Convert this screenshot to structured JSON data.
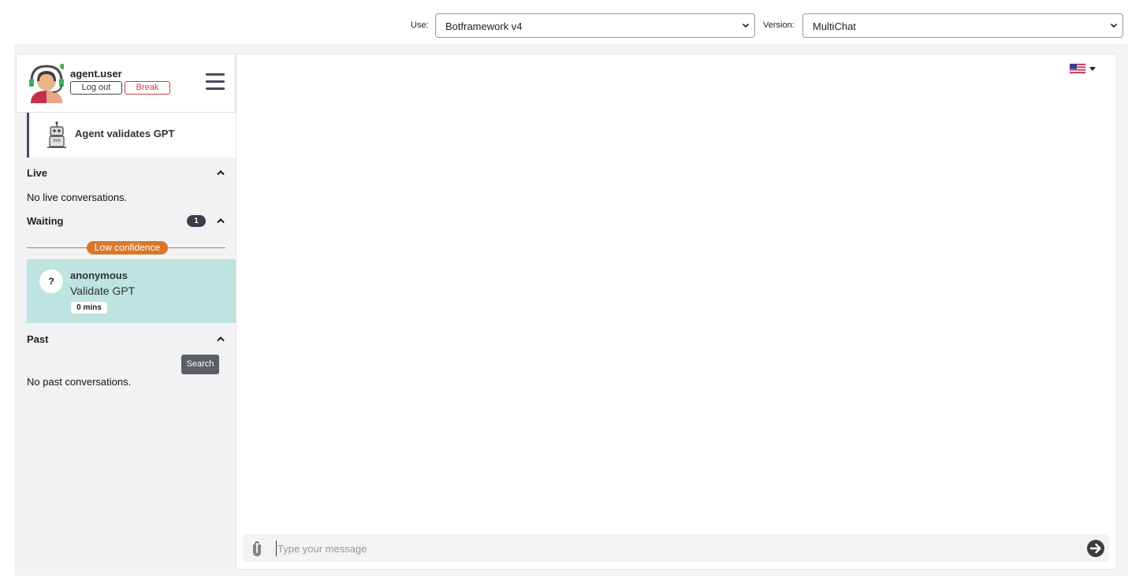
{
  "topbar": {
    "use_label": "Use:",
    "use_value": "Botframework v4",
    "version_label": "Version:",
    "version_value": "MultiChat"
  },
  "agent": {
    "name": "agent.user",
    "status_color": "#4caf50",
    "logout_label": "Log out",
    "break_label": "Break"
  },
  "bot": {
    "label": "Agent validates GPT"
  },
  "sections": {
    "live": {
      "title": "Live",
      "empty": "No live conversations."
    },
    "waiting": {
      "title": "Waiting",
      "count": "1",
      "group_label": "Low confidence",
      "conversations": [
        {
          "avatar": "?",
          "name": "anonymous",
          "message": "Validate GPT",
          "time": "0 mins"
        }
      ]
    },
    "past": {
      "title": "Past",
      "search_label": "Search",
      "empty": "No past conversations."
    }
  },
  "composer": {
    "placeholder": "Type your message"
  },
  "colors": {
    "accent_orange": "#d8782b",
    "waiting_item_bg": "#bde4e0",
    "break_red": "#c9404b"
  }
}
